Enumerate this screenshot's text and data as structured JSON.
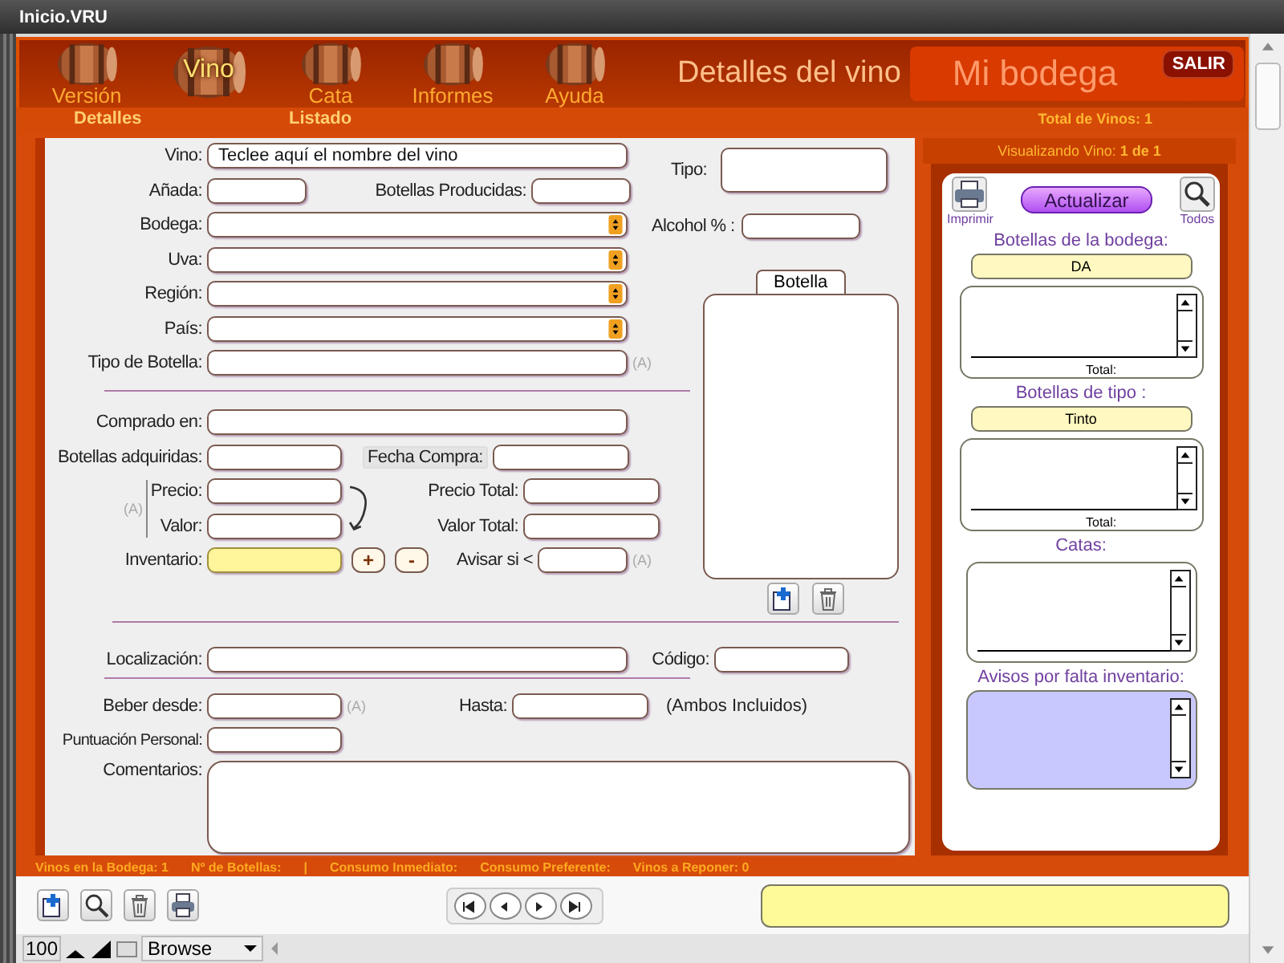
{
  "window": {
    "title": "Inicio.VRU"
  },
  "nav": [
    {
      "label": "Versión",
      "selected": false
    },
    {
      "label": "Vino",
      "selected": true
    },
    {
      "label": "Cata",
      "selected": false
    },
    {
      "label": "Informes",
      "selected": false
    },
    {
      "label": "Ayuda",
      "selected": false
    }
  ],
  "subnav": [
    "Detalles",
    "Listado"
  ],
  "header": {
    "section_title": "Detalles del vino",
    "app_title": "Mi bodega",
    "exit_button": "SALIR",
    "total": "Total de Vinos: **1**",
    "viewing": "Visualizando Vino: **1 de 1**"
  },
  "form": {
    "vino": {
      "label": "Vino:",
      "value": "Teclee aquí el nombre del vino"
    },
    "anada": {
      "label": "Añada:"
    },
    "producidas": {
      "label": "Botellas Producidas:"
    },
    "selects": [
      {
        "label": "Bodega:"
      },
      {
        "label": "Uva:"
      },
      {
        "label": "Región:"
      },
      {
        "label": "País:"
      }
    ],
    "tipo_botella": {
      "label": "Tipo de Botella:",
      "note": "(A)"
    },
    "tipo": {
      "label": "Tipo:"
    },
    "alcohol": {
      "label": "Alcohol % :"
    },
    "photo_tab": "Botella",
    "comprado": {
      "label": "Comprado en:"
    },
    "adquiridas": {
      "label": "Botellas adquiridas:"
    },
    "fecha": {
      "label": "Fecha Compra:"
    },
    "precio_note": "(A)",
    "precio": {
      "label": "Precio:"
    },
    "precio_total": {
      "label": "Precio Total:"
    },
    "valor": {
      "label": "Valor:"
    },
    "valor_total": {
      "label": "Valor Total:"
    },
    "inventario": {
      "label": "Inventario:",
      "plus": "+",
      "minus": "-"
    },
    "avisar": {
      "label": "Avisar si <",
      "note": "(A)"
    },
    "localizacion": {
      "label": "Localización:"
    },
    "codigo": {
      "label": "Código:"
    },
    "beber": {
      "label": "Beber desde:",
      "note": "(A)"
    },
    "hasta": {
      "label": "Hasta:",
      "note": "(Ambos Incluidos)"
    },
    "puntuacion": {
      "label": "Puntuación Personal:"
    },
    "comentarios": {
      "label": "Comentarios:"
    }
  },
  "side": {
    "print": "Imprimir",
    "refresh": "Actualizar",
    "all": "Todos",
    "lists": [
      {
        "kind": "filtered",
        "title": "Botellas de la bodega:",
        "filter": "DA",
        "total": "Total:"
      },
      {
        "kind": "filtered",
        "title": "Botellas de tipo :",
        "filter": "Tinto",
        "total": "Total:"
      },
      {
        "kind": "plain",
        "title": "Catas:"
      },
      {
        "kind": "alert",
        "title": "Avisos por falta inventario:"
      }
    ]
  },
  "status_bar": [
    "Vinos en la Bodega: 1",
    "Nº de Botellas:",
    "|",
    "Consumo Inmediato:",
    "Consumo Preferente:",
    "Vinos a Reponer: 0"
  ],
  "footer": {
    "zoom": "100",
    "mode": "Browse"
  }
}
